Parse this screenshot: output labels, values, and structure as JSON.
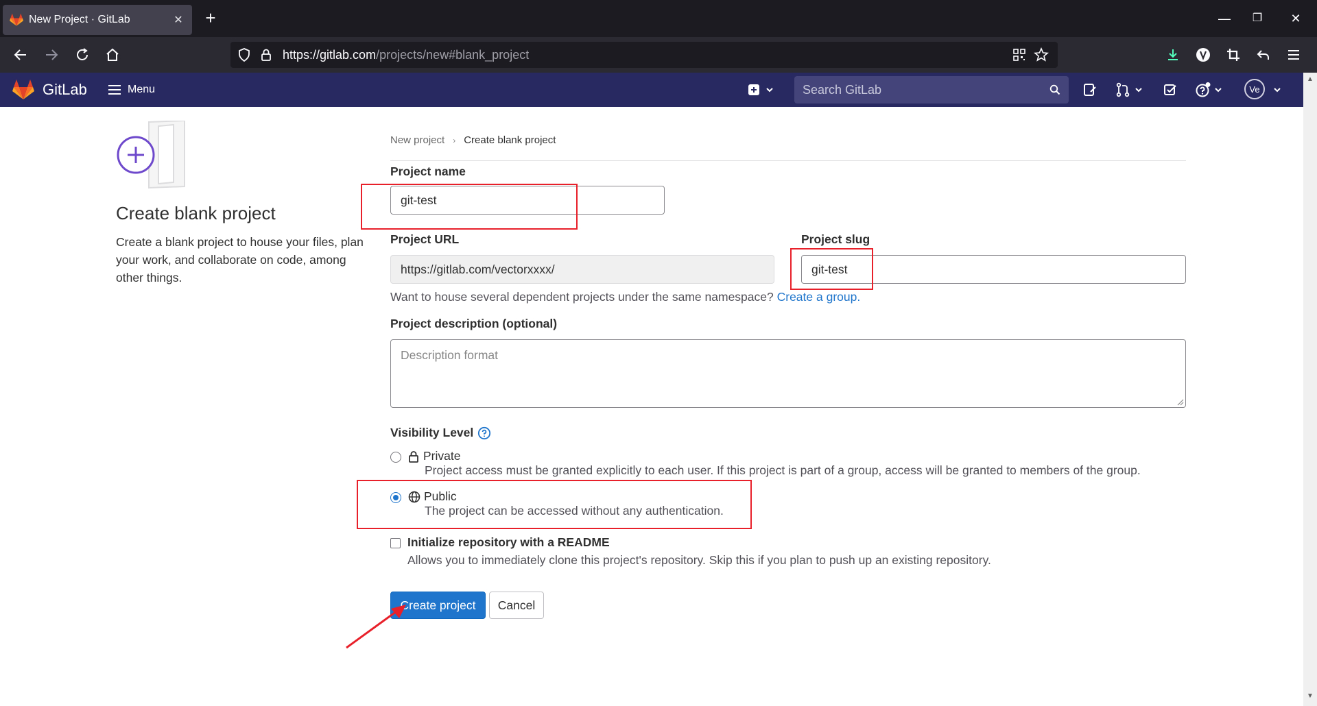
{
  "browser": {
    "tab_title": "New Project · GitLab",
    "url_host": "https://gitlab.com",
    "url_path": "/projects/new#blank_project"
  },
  "gitlab_header": {
    "brand": "GitLab",
    "menu_label": "Menu",
    "search_placeholder": "Search GitLab",
    "avatar_initials": "Ve"
  },
  "sidebar": {
    "title": "Create blank project",
    "description": "Create a blank project to house your files, plan your work, and collaborate on code, among other things."
  },
  "breadcrumb": {
    "parent": "New project",
    "current": "Create blank project"
  },
  "form": {
    "project_name_label": "Project name",
    "project_name_value": "git-test",
    "project_url_label": "Project URL",
    "project_url_value": "https://gitlab.com/vectorxxxx/",
    "project_slug_label": "Project slug",
    "project_slug_value": "git-test",
    "namespace_help": "Want to house several dependent projects under the same namespace?",
    "create_group_link": "Create a group.",
    "description_label": "Project description (optional)",
    "description_placeholder": "Description format",
    "visibility_label": "Visibility Level",
    "visibility_options": [
      {
        "title": "Private",
        "description": "Project access must be granted explicitly to each user. If this project is part of a group, access will be granted to members of the group.",
        "selected": false
      },
      {
        "title": "Public",
        "description": "The project can be accessed without any authentication.",
        "selected": true
      }
    ],
    "readme_label": "Initialize repository with a README",
    "readme_description": "Allows you to immediately clone this project's repository. Skip this if you plan to push up an existing repository.",
    "readme_checked": false,
    "create_button": "Create project",
    "cancel_button": "Cancel"
  },
  "colors": {
    "gitlab_header": "#292961",
    "primary": "#1f75cb",
    "annotation": "#e8202a"
  }
}
